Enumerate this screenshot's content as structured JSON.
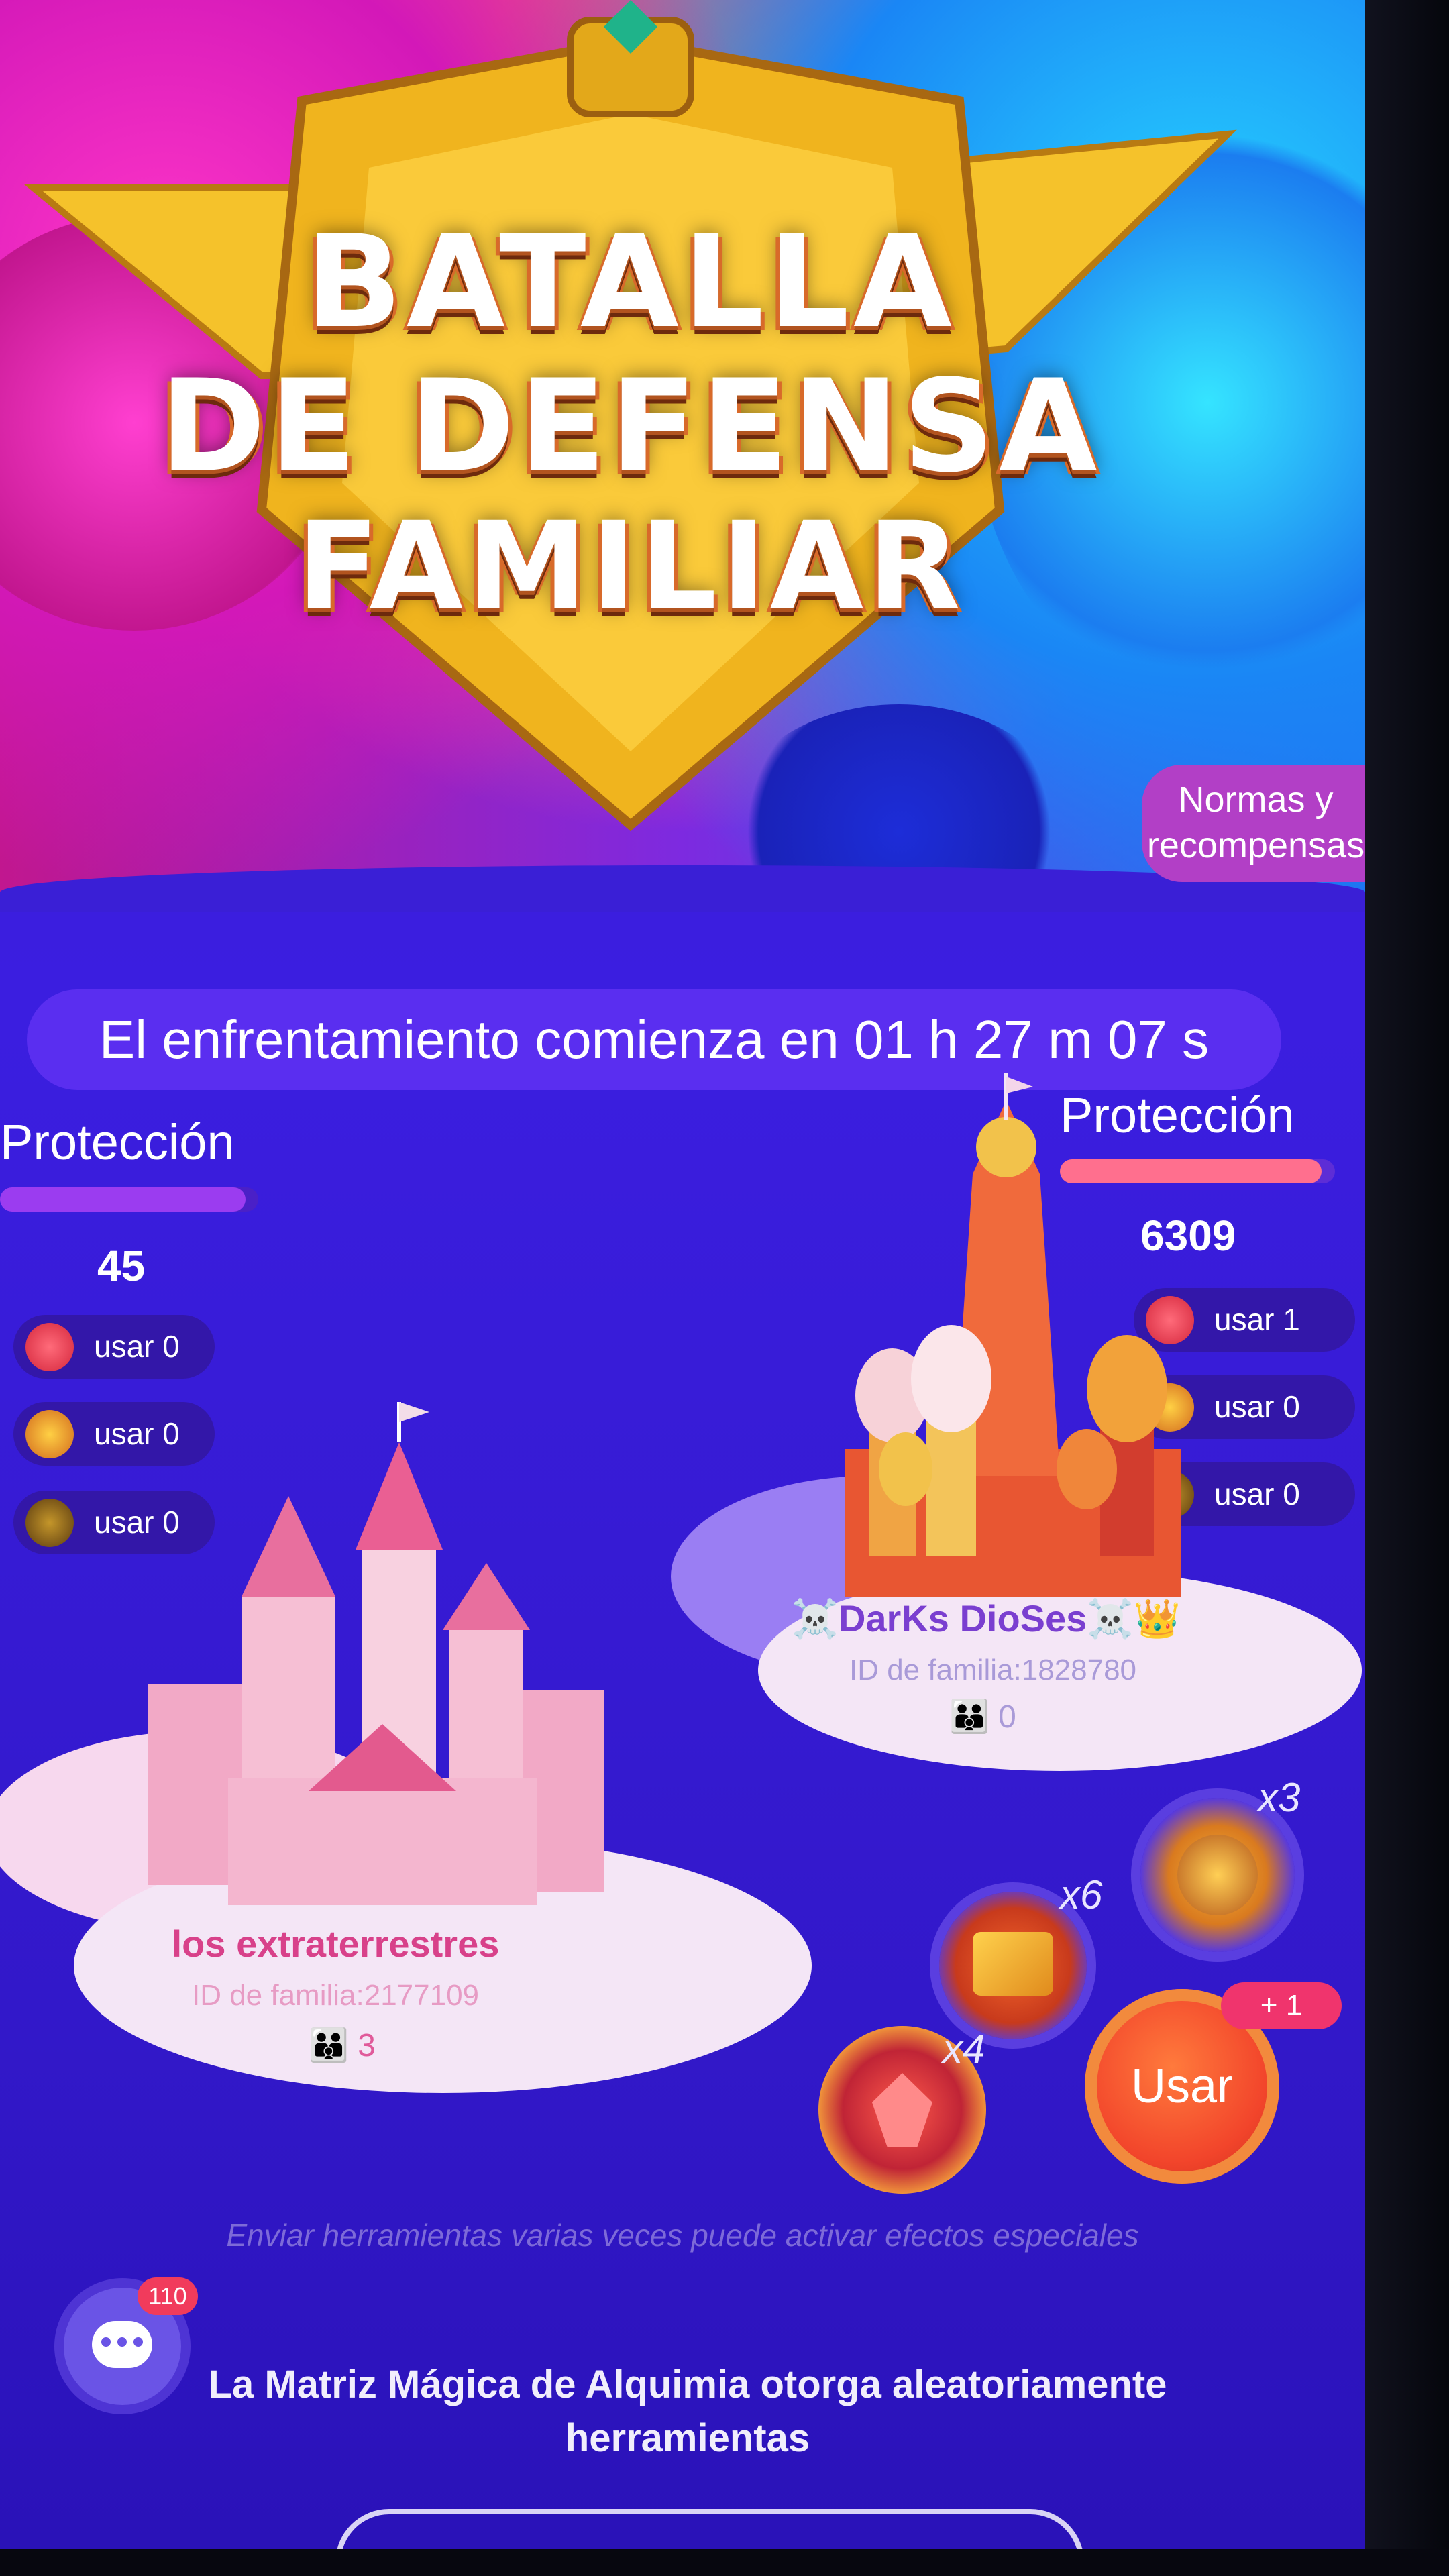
{
  "banner": {
    "title_line1": "BATALLA",
    "title_line2": "DE DEFENSA",
    "title_line3": "FAMILIAR",
    "rules_button": "Normas y recompensas"
  },
  "countdown": {
    "text": "El enfrentamiento comienza en 01 h 27 m 07 s"
  },
  "left_family": {
    "protection_label": "Protección",
    "protection_value": "45",
    "protection_fill": 0.95,
    "tools": [
      {
        "icon": "red-crystal-icon",
        "label": "usar 0"
      },
      {
        "icon": "golden-book-icon",
        "label": "usar 0"
      },
      {
        "icon": "golden-orb-icon",
        "label": "usar 0"
      }
    ],
    "name": "los extraterrestres",
    "family_id": "ID de familia:2177109",
    "members": "3"
  },
  "right_family": {
    "protection_label": "Protección",
    "protection_value": "6309",
    "protection_fill": 0.95,
    "tools": [
      {
        "icon": "red-crystal-icon",
        "label": "usar 1"
      },
      {
        "icon": "golden-book-icon",
        "label": "usar 0"
      },
      {
        "icon": "golden-orb-icon",
        "label": "usar 0"
      }
    ],
    "name": "☠️DarKs DioSes☠️👑",
    "family_id": "ID de familia:1828780",
    "members": "0"
  },
  "inventory": {
    "orb_count": "x3",
    "book_count": "x6",
    "crystal_count": "x4",
    "use_button": "Usar",
    "use_badge": "+ 1"
  },
  "hint": "Enviar herramientas varias veces puede activar efectos especiales",
  "chat": {
    "badge": "110"
  },
  "footer": {
    "text": "La Matriz Mágica de Alquimia otorga aleatoriamente herramientas"
  },
  "colors": {
    "background": "#3a1fd6",
    "left_bar": "#9b3cf0",
    "right_bar": "#ff6f8e",
    "use_button": "#f2452b"
  }
}
